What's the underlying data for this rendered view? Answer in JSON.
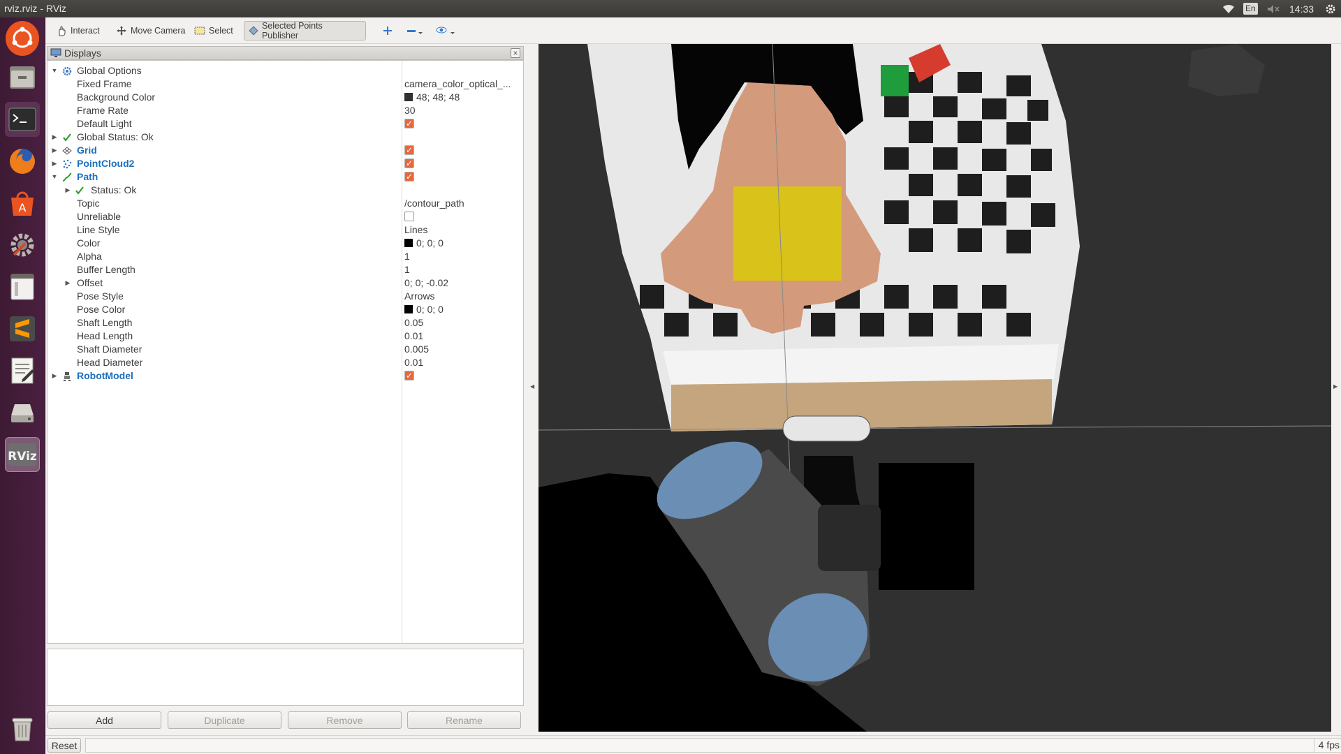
{
  "window_title": "rviz.rviz - RViz",
  "topbar": {
    "lang": "En",
    "time": "14:33"
  },
  "launcher": [
    "ubuntu-dash",
    "files",
    "terminal",
    "firefox",
    "software-center",
    "system-settings",
    "window-app",
    "sublime-text",
    "text-editor",
    "disk-drive",
    "rviz",
    "trash"
  ],
  "toolbar": {
    "interact": "Interact",
    "move_camera": "Move Camera",
    "select": "Select",
    "selected_points_publisher": "Selected Points Publisher"
  },
  "displays": {
    "title": "Displays",
    "rows": [
      {
        "name": "Global Options",
        "value": ""
      },
      {
        "name": "Fixed Frame",
        "value": "camera_color_optical_..."
      },
      {
        "name": "Background Color",
        "value": "48; 48; 48"
      },
      {
        "name": "Frame Rate",
        "value": "30"
      },
      {
        "name": "Default Light",
        "value": ""
      },
      {
        "name": "Global Status: Ok",
        "value": ""
      },
      {
        "name": "Grid",
        "value": ""
      },
      {
        "name": "PointCloud2",
        "value": ""
      },
      {
        "name": "Path",
        "value": ""
      },
      {
        "name": "Status: Ok",
        "value": ""
      },
      {
        "name": "Topic",
        "value": "/contour_path"
      },
      {
        "name": "Unreliable",
        "value": ""
      },
      {
        "name": "Line Style",
        "value": "Lines"
      },
      {
        "name": "Color",
        "value": "0; 0; 0"
      },
      {
        "name": "Alpha",
        "value": "1"
      },
      {
        "name": "Buffer Length",
        "value": "1"
      },
      {
        "name": "Offset",
        "value": "0; 0; -0.02"
      },
      {
        "name": "Pose Style",
        "value": "Arrows"
      },
      {
        "name": "Pose Color",
        "value": "0; 0; 0"
      },
      {
        "name": "Shaft Length",
        "value": "0.05"
      },
      {
        "name": "Head Length",
        "value": "0.01"
      },
      {
        "name": "Shaft Diameter",
        "value": "0.005"
      },
      {
        "name": "Head Diameter",
        "value": "0.01"
      },
      {
        "name": "RobotModel",
        "value": ""
      }
    ],
    "buttons": {
      "add": "Add",
      "duplicate": "Duplicate",
      "remove": "Remove",
      "rename": "Rename"
    }
  },
  "statusbar": {
    "reset": "Reset",
    "fps": "4 fps"
  },
  "colors": {
    "accent_checkbox": "#e9673c",
    "display_name_blue": "#1d6fbd",
    "status_ok_green": "#2e9e2e",
    "view_background": "#303030"
  }
}
